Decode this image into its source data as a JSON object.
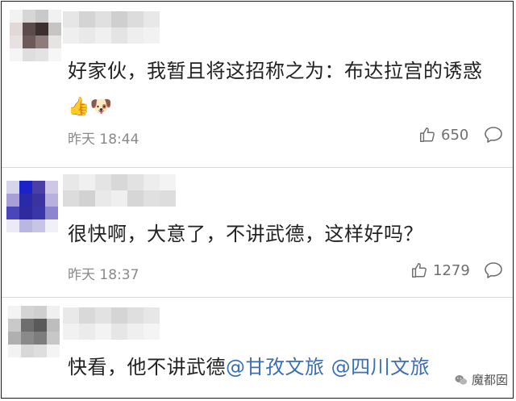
{
  "comments": [
    {
      "text": "好家伙，我暂且将这招称之为：布达拉宫的诱惑",
      "emoji_1": "👍",
      "emoji_2": "🐶",
      "time": "昨天 18:44",
      "likes": "650"
    },
    {
      "text": "很快啊，大意了，不讲武德，这样好吗？",
      "time": "昨天 18:37",
      "likes": "1279"
    },
    {
      "text_prefix": "快看，他不讲武德",
      "mention_1": "@甘孜文旅",
      "mention_2": "@四川文旅"
    }
  ],
  "watermark": {
    "text": "魔都囡"
  },
  "colors": {
    "mention": "#3a6fb7",
    "text": "#222222",
    "meta": "#8a8a8a"
  }
}
